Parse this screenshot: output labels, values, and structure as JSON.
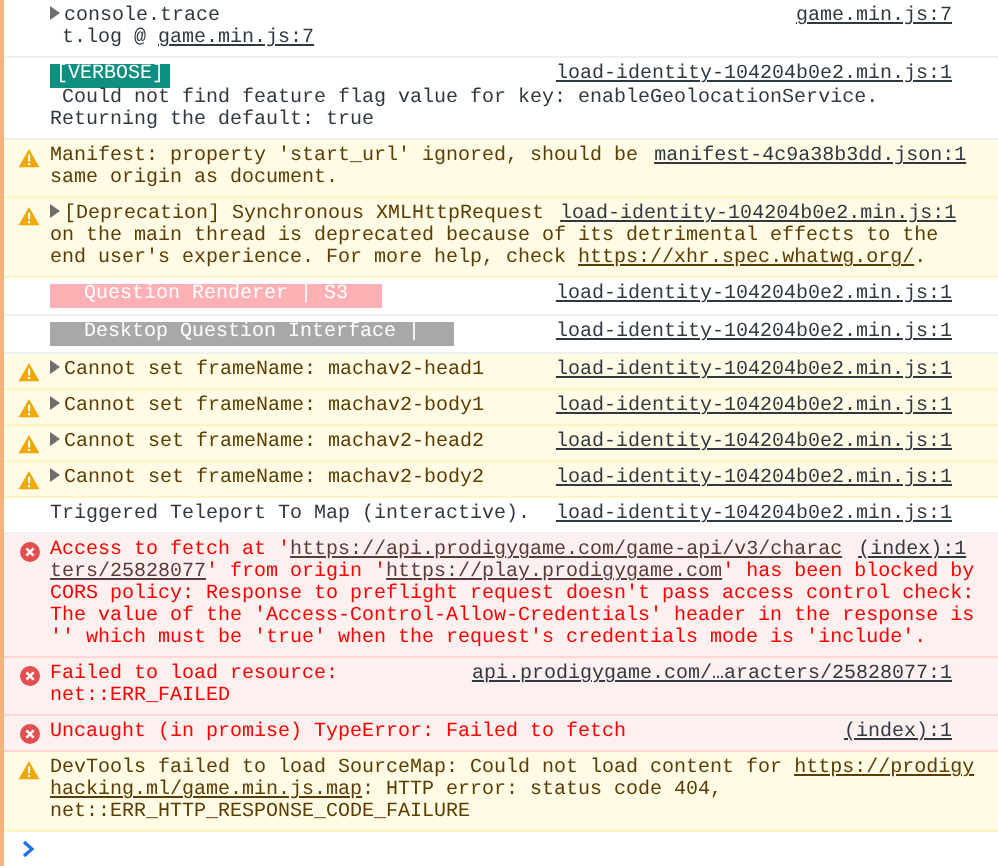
{
  "messages": [
    {
      "kind": "log",
      "expandable": true,
      "source": "game.min.js:7",
      "lines": [
        [
          {
            "text": "console.trace"
          }
        ],
        [
          {
            "text": " t.log @ "
          },
          {
            "link": "game.min.js:7"
          }
        ]
      ]
    },
    {
      "kind": "log",
      "expandable": false,
      "badge": {
        "text": "[VERBOSE]",
        "color": "#0f8f80"
      },
      "source": "load-identity-104204b0e2.min.js:1",
      "lines": [
        [
          {
            "text": " Could not find feature flag value for key: enableGeolocationService."
          }
        ],
        [
          {
            "text": "Returning the default: true"
          }
        ]
      ]
    },
    {
      "kind": "warning",
      "expandable": false,
      "source": "manifest-4c9a38b3dd.json:1",
      "lines": [
        [
          {
            "text": "Manifest: property 'start_url' ignored, should be"
          }
        ],
        [
          {
            "text": "same origin as document."
          }
        ]
      ]
    },
    {
      "kind": "warning",
      "expandable": true,
      "source": "load-identity-104204b0e2.min.js:1",
      "lines": [
        [
          {
            "text": "[Deprecation] Synchronous XMLHttpRequest"
          }
        ],
        [
          {
            "text": "on the main thread is deprecated because of its detrimental effects to the"
          }
        ],
        [
          {
            "text": "end user's experience. For more help, check "
          },
          {
            "link": "https://xhr.spec.whatwg.org/"
          },
          {
            "text": "."
          }
        ]
      ]
    },
    {
      "kind": "log",
      "expandable": false,
      "badge": {
        "text": "Question Renderer | S3",
        "color": "#ffb0b5"
      },
      "source": "load-identity-104204b0e2.min.js:1"
    },
    {
      "kind": "log",
      "expandable": false,
      "badge": {
        "text": "Desktop Question Interface |",
        "color": "#a8a8a8"
      },
      "source": "load-identity-104204b0e2.min.js:1"
    },
    {
      "kind": "warning",
      "expandable": true,
      "source": "load-identity-104204b0e2.min.js:1",
      "lines": [
        [
          {
            "text": "Cannot set frameName: machav2-head1"
          }
        ]
      ]
    },
    {
      "kind": "warning",
      "expandable": true,
      "source": "load-identity-104204b0e2.min.js:1",
      "lines": [
        [
          {
            "text": "Cannot set frameName: machav2-body1"
          }
        ]
      ]
    },
    {
      "kind": "warning",
      "expandable": true,
      "source": "load-identity-104204b0e2.min.js:1",
      "lines": [
        [
          {
            "text": "Cannot set frameName: machav2-head2"
          }
        ]
      ]
    },
    {
      "kind": "warning",
      "expandable": true,
      "source": "load-identity-104204b0e2.min.js:1",
      "lines": [
        [
          {
            "text": "Cannot set frameName: machav2-body2"
          }
        ]
      ]
    },
    {
      "kind": "log",
      "expandable": false,
      "source": "load-identity-104204b0e2.min.js:1",
      "lines": [
        [
          {
            "text": "Triggered Teleport To Map (interactive)."
          }
        ]
      ]
    },
    {
      "kind": "error",
      "expandable": false,
      "source": "(index):1",
      "lines": [
        [
          {
            "text": "Access to fetch at '"
          },
          {
            "link": "https://api.prodigygame.com/game-api/v3/charac"
          }
        ],
        [
          {
            "link": "ters/25828077"
          },
          {
            "text": "' from origin '"
          },
          {
            "link": "https://play.prodigygame.com"
          },
          {
            "text": "' has been blocked by"
          }
        ],
        [
          {
            "text": "CORS policy: Response to preflight request doesn't pass access control check:"
          }
        ],
        [
          {
            "text": "The value of the 'Access-Control-Allow-Credentials' header in the response is"
          }
        ],
        [
          {
            "text": "'' which must be 'true' when the request's credentials mode is 'include'."
          }
        ]
      ]
    },
    {
      "kind": "error",
      "expandable": false,
      "source": "api.prodigygame.com/…aracters/25828077:1",
      "lines": [
        [
          {
            "text": "Failed to load resource:"
          }
        ],
        [
          {
            "text": "net::ERR_FAILED"
          }
        ]
      ]
    },
    {
      "kind": "error",
      "expandable": false,
      "source": "(index):1",
      "lines": [
        [
          {
            "text": "Uncaught (in promise) TypeError: Failed to fetch"
          }
        ]
      ]
    },
    {
      "kind": "warning",
      "expandable": false,
      "lines": [
        [
          {
            "text": "DevTools failed to load SourceMap: Could not load content for "
          },
          {
            "link": "https://prodigy"
          }
        ],
        [
          {
            "link": "hacking.ml/game.min.js.map"
          },
          {
            "text": ": HTTP error: status code 404,"
          }
        ],
        [
          {
            "text": "net::ERR_HTTP_RESPONSE_CODE_FAILURE"
          }
        ]
      ]
    }
  ]
}
